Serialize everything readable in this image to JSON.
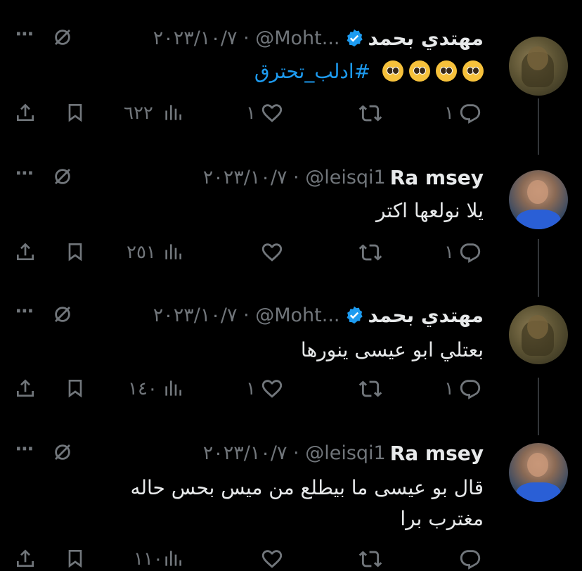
{
  "tweets": [
    {
      "name": "مهتدي بحمد",
      "verified": true,
      "meta": "٢٠٢٣/١٠/٧ · @Moht...",
      "hashtag": "#ادلب_تحترق",
      "text": "",
      "emoji_count": 4,
      "emoji": "pleading-face",
      "reply_count": "١",
      "retweet_count": "",
      "like_count": "١",
      "view_count": "٦٢٢"
    },
    {
      "name": "Ra msey",
      "verified": false,
      "meta": "٢٠٢٣/١٠/٧ · @leisqi1",
      "text": "يلا نولعها اكتر",
      "reply_count": "١",
      "retweet_count": "",
      "like_count": "",
      "view_count": "٢٥١"
    },
    {
      "name": "مهتدي بحمد",
      "verified": true,
      "meta": "٢٠٢٣/١٠/٧ · @Moht...",
      "text": "بعتلي ابو عيسى ينورها",
      "reply_count": "١",
      "retweet_count": "",
      "like_count": "١",
      "view_count": "١٤٠"
    },
    {
      "name": "Ra msey",
      "verified": false,
      "meta": "٢٠٢٣/١٠/٧ · @leisqi1",
      "text_line1": "قال بو عيسى ما بيطلع من ميس بحس حاله",
      "text_line2": "مغترب برا",
      "reply_count": "",
      "retweet_count": "",
      "like_count": "",
      "view_count": "١١٠"
    }
  ],
  "icons": {
    "more": "⋯",
    "mute": "mute-icon",
    "share": "share-icon",
    "bookmark": "bookmark-icon",
    "views": "views-icon",
    "like": "heart-icon",
    "retweet": "retweet-icon",
    "reply": "reply-icon"
  },
  "colors": {
    "background": "#000000",
    "text": "#e7e9ea",
    "muted": "#71767b",
    "accent": "#1d9bf0"
  }
}
